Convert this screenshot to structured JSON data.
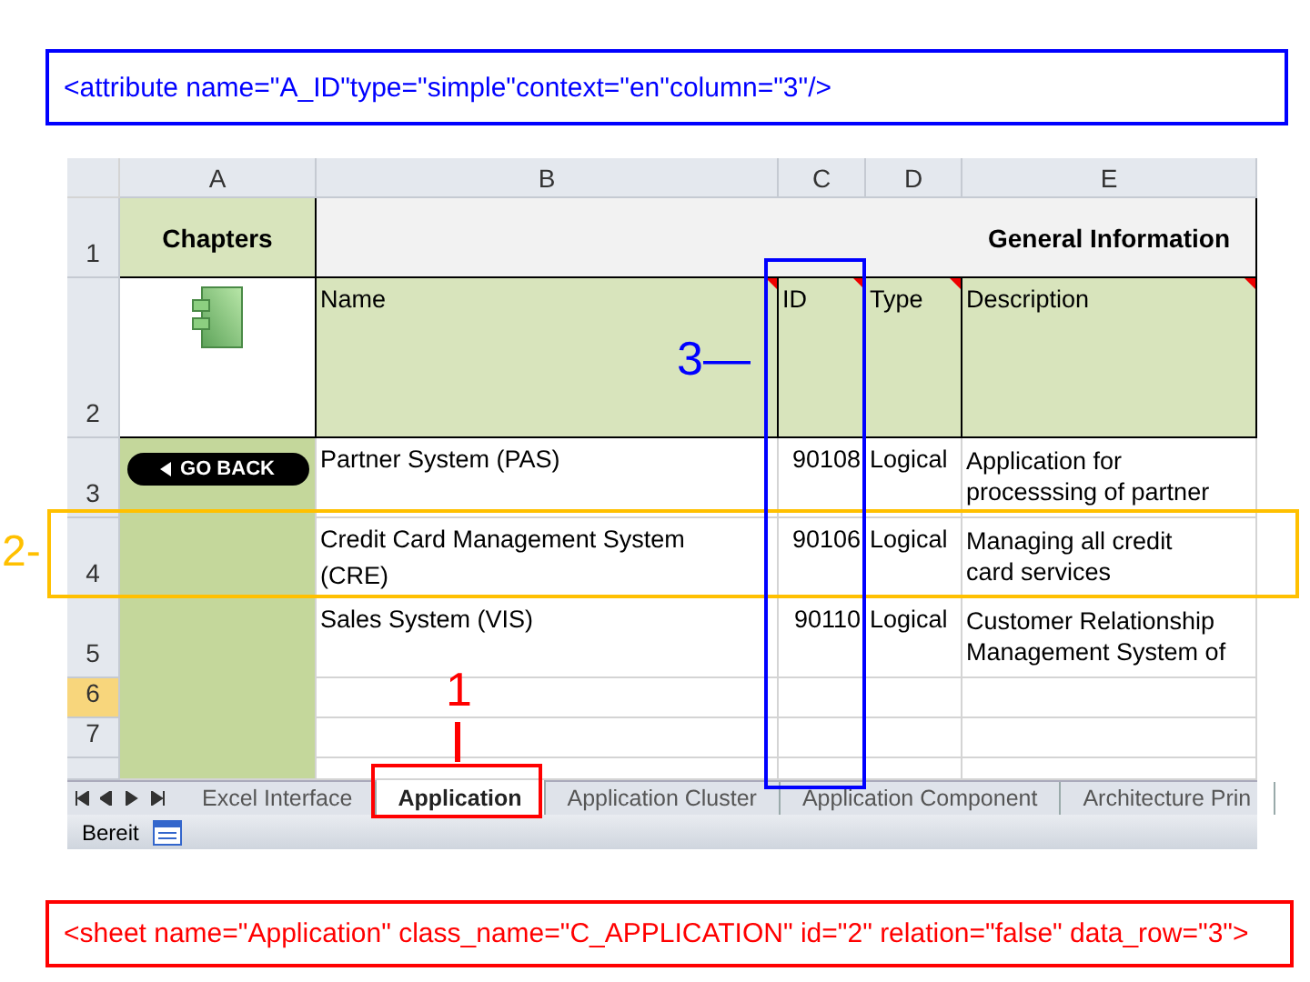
{
  "top_annotation": "<attribute name=\"A_ID\"type=\"simple\"context=\"en\"column=\"3\"/>",
  "bottom_annotation": "<sheet name=\"Application\" class_name=\"C_APPLICATION\" id=\"2\" relation=\"false\" data_row=\"3\">",
  "callouts": [
    {
      "label": "1",
      "color": "#ff0000"
    },
    {
      "label": "2-",
      "color": "#ffc000"
    },
    {
      "label": "3—",
      "color": "#0000ff"
    }
  ],
  "spreadsheet": {
    "columns": [
      "A",
      "B",
      "C",
      "D",
      "E"
    ],
    "row_numbers": [
      {
        "label": "1",
        "selected": false
      },
      {
        "label": "2",
        "selected": false
      },
      {
        "label": "3",
        "selected": false
      },
      {
        "label": "4",
        "selected": false
      },
      {
        "label": "5",
        "selected": false
      },
      {
        "label": "6",
        "selected": true
      },
      {
        "label": "7",
        "selected": false
      }
    ],
    "chapters": "Chapters",
    "section_title": "General Information",
    "back_button": "GO BACK",
    "headers": [
      {
        "label": "Name",
        "has_comment": true
      },
      {
        "label": "ID",
        "has_comment": true
      },
      {
        "label": "Type",
        "has_comment": true
      },
      {
        "label": "Description",
        "has_comment": true
      }
    ],
    "rows": [
      {
        "name": [
          "Partner System (PAS)"
        ],
        "id": "90108",
        "type": "Logical",
        "description": [
          "Application for",
          "processsing of partner"
        ]
      },
      {
        "name": [
          "Credit Card Management System",
          "(CRE)"
        ],
        "id": "90106",
        "type": "Logical",
        "description": [
          "Managing all credit",
          "card services"
        ]
      },
      {
        "name": [
          "Sales System (VIS)"
        ],
        "id": "90110",
        "type": "Logical",
        "description": [
          "Customer Relationship",
          "Management System of"
        ]
      }
    ]
  },
  "sheet_tabs": [
    {
      "label": "Excel Interface",
      "selected": false
    },
    {
      "label": "Application",
      "selected": true
    },
    {
      "label": "Application Cluster",
      "selected": false
    },
    {
      "label": "Application Component",
      "selected": false
    },
    {
      "label": "Architecture Prin",
      "selected": false
    }
  ],
  "status_bar": {
    "text": "Bereit"
  }
}
